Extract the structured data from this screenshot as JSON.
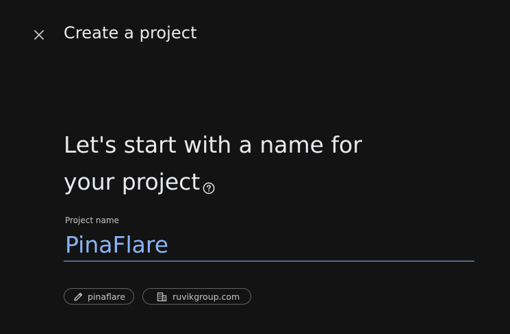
{
  "header": {
    "close_icon": "close-icon",
    "title": "Create a project"
  },
  "main": {
    "heading_line1": "Let's start with a name for",
    "heading_line2": "your project",
    "help_icon": "help-circle-icon"
  },
  "project_name_field": {
    "label": "Project name",
    "value": "PinaFlare"
  },
  "chips": [
    {
      "icon": "pencil-icon",
      "label": "pinaflare"
    },
    {
      "icon": "building-icon",
      "label": "ruvikgroup.com"
    }
  ],
  "colors": {
    "background": "#131313",
    "text": "#e8eaed",
    "accent": "#8ab4f8",
    "muted": "#c4c7c5",
    "chip_border": "#5f6368"
  }
}
